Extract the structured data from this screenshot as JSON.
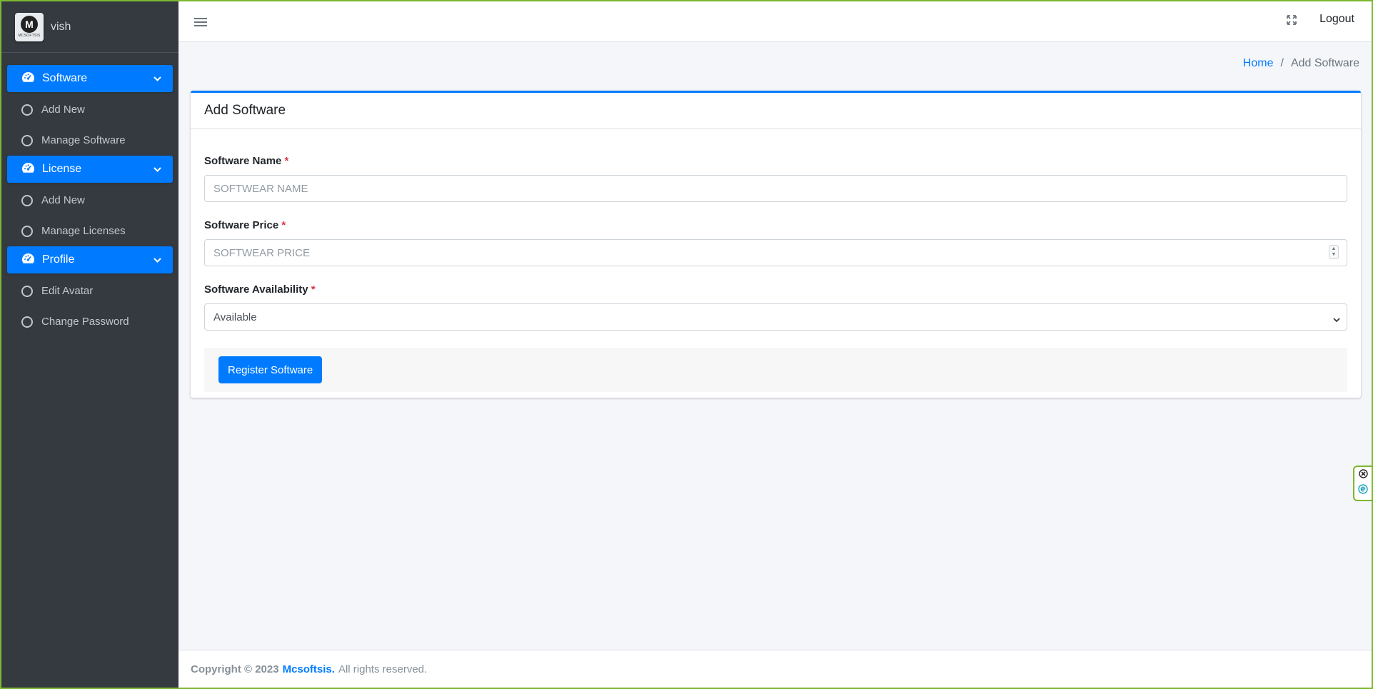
{
  "brand": {
    "name": "vish",
    "logo_letter": "M",
    "logo_text": "MCSOFTSIS"
  },
  "sidebar": {
    "groups": [
      {
        "label": "Software",
        "items": [
          {
            "label": "Add New"
          },
          {
            "label": "Manage Software"
          }
        ]
      },
      {
        "label": "License",
        "items": [
          {
            "label": "Add New"
          },
          {
            "label": "Manage Licenses"
          }
        ]
      },
      {
        "label": "Profile",
        "items": [
          {
            "label": "Edit Avatar"
          },
          {
            "label": "Change Password"
          }
        ]
      }
    ]
  },
  "topbar": {
    "logout_label": "Logout"
  },
  "breadcrumb": {
    "home": "Home",
    "separator": "/",
    "current": "Add Software"
  },
  "card": {
    "title": "Add Software",
    "fields": {
      "name": {
        "label": "Software Name",
        "required_mark": "*",
        "placeholder": "SOFTWEAR NAME",
        "value": ""
      },
      "price": {
        "label": "Software Price",
        "required_mark": "*",
        "placeholder": "SOFTWEAR PRICE",
        "value": ""
      },
      "availability": {
        "label": "Software Availability",
        "required_mark": "*",
        "selected": "Available"
      }
    },
    "submit_label": "Register Software"
  },
  "footer": {
    "copyright": "Copyright © 2023",
    "brand_link": "Mcsoftsis.",
    "rights": "All rights reserved."
  },
  "colors": {
    "primary": "#007bff",
    "sidebar_bg": "#343a40",
    "required": "#dc3545",
    "frame_border": "#7cb82f"
  }
}
